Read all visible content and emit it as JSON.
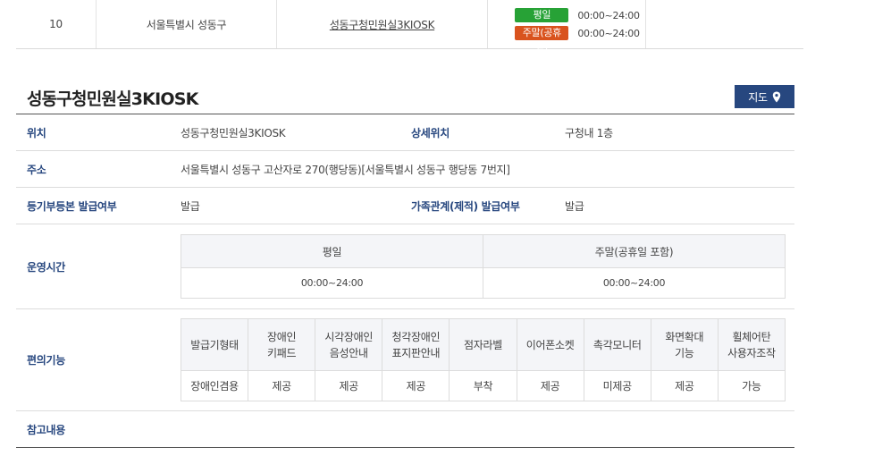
{
  "list_row": {
    "number": "10",
    "area": "서울특별시 성동구",
    "name": "성동구청민원실3KIOSK",
    "weekday_badge": "평일",
    "weekday_time": "00:00~24:00",
    "weekend_badge": "주말(공휴일)",
    "weekend_time": "00:00~24:00",
    "colors": {
      "weekday_badge": "#27a236",
      "weekend_badge": "#d9531e"
    }
  },
  "detail": {
    "title": "성동구청민원실3KIOSK",
    "map_button": "지도",
    "map_icon": "map-pin-icon",
    "location_label": "위치",
    "location_value": "성동구청민원실3KIOSK",
    "detail_location_label": "상세위치",
    "detail_location_value": "구청내 1층",
    "address_label": "주소",
    "address_value": "서울특별시 성동구 고산자로 270(행당동)[서울특별시 성동구 행당동 7번지]",
    "registry_label": "등기부등본 발급여부",
    "registry_value": "발급",
    "family_label": "가족관계(제적) 발급여부",
    "family_value": "발급",
    "hours_label": "운영시간",
    "hours": {
      "headers": [
        "평일",
        "주말(공휴일 포함)"
      ],
      "values": [
        "00:00~24:00",
        "00:00~24:00"
      ]
    },
    "convenience_label": "편의기능",
    "convenience": {
      "headers": [
        "발급기형태",
        "장애인\n키패드",
        "시각장애인\n음성안내",
        "청각장애인\n표지판안내",
        "점자라벨",
        "이어폰소켓",
        "촉각모니터",
        "화면확대\n기능",
        "휠체어탄\n사용자조작"
      ],
      "values": [
        "장애인겸용",
        "제공",
        "제공",
        "제공",
        "부착",
        "제공",
        "미제공",
        "제공",
        "가능"
      ]
    },
    "notes_label": "참고내용",
    "colors": {
      "label": "#27477f",
      "map_button": "#27477f"
    }
  }
}
